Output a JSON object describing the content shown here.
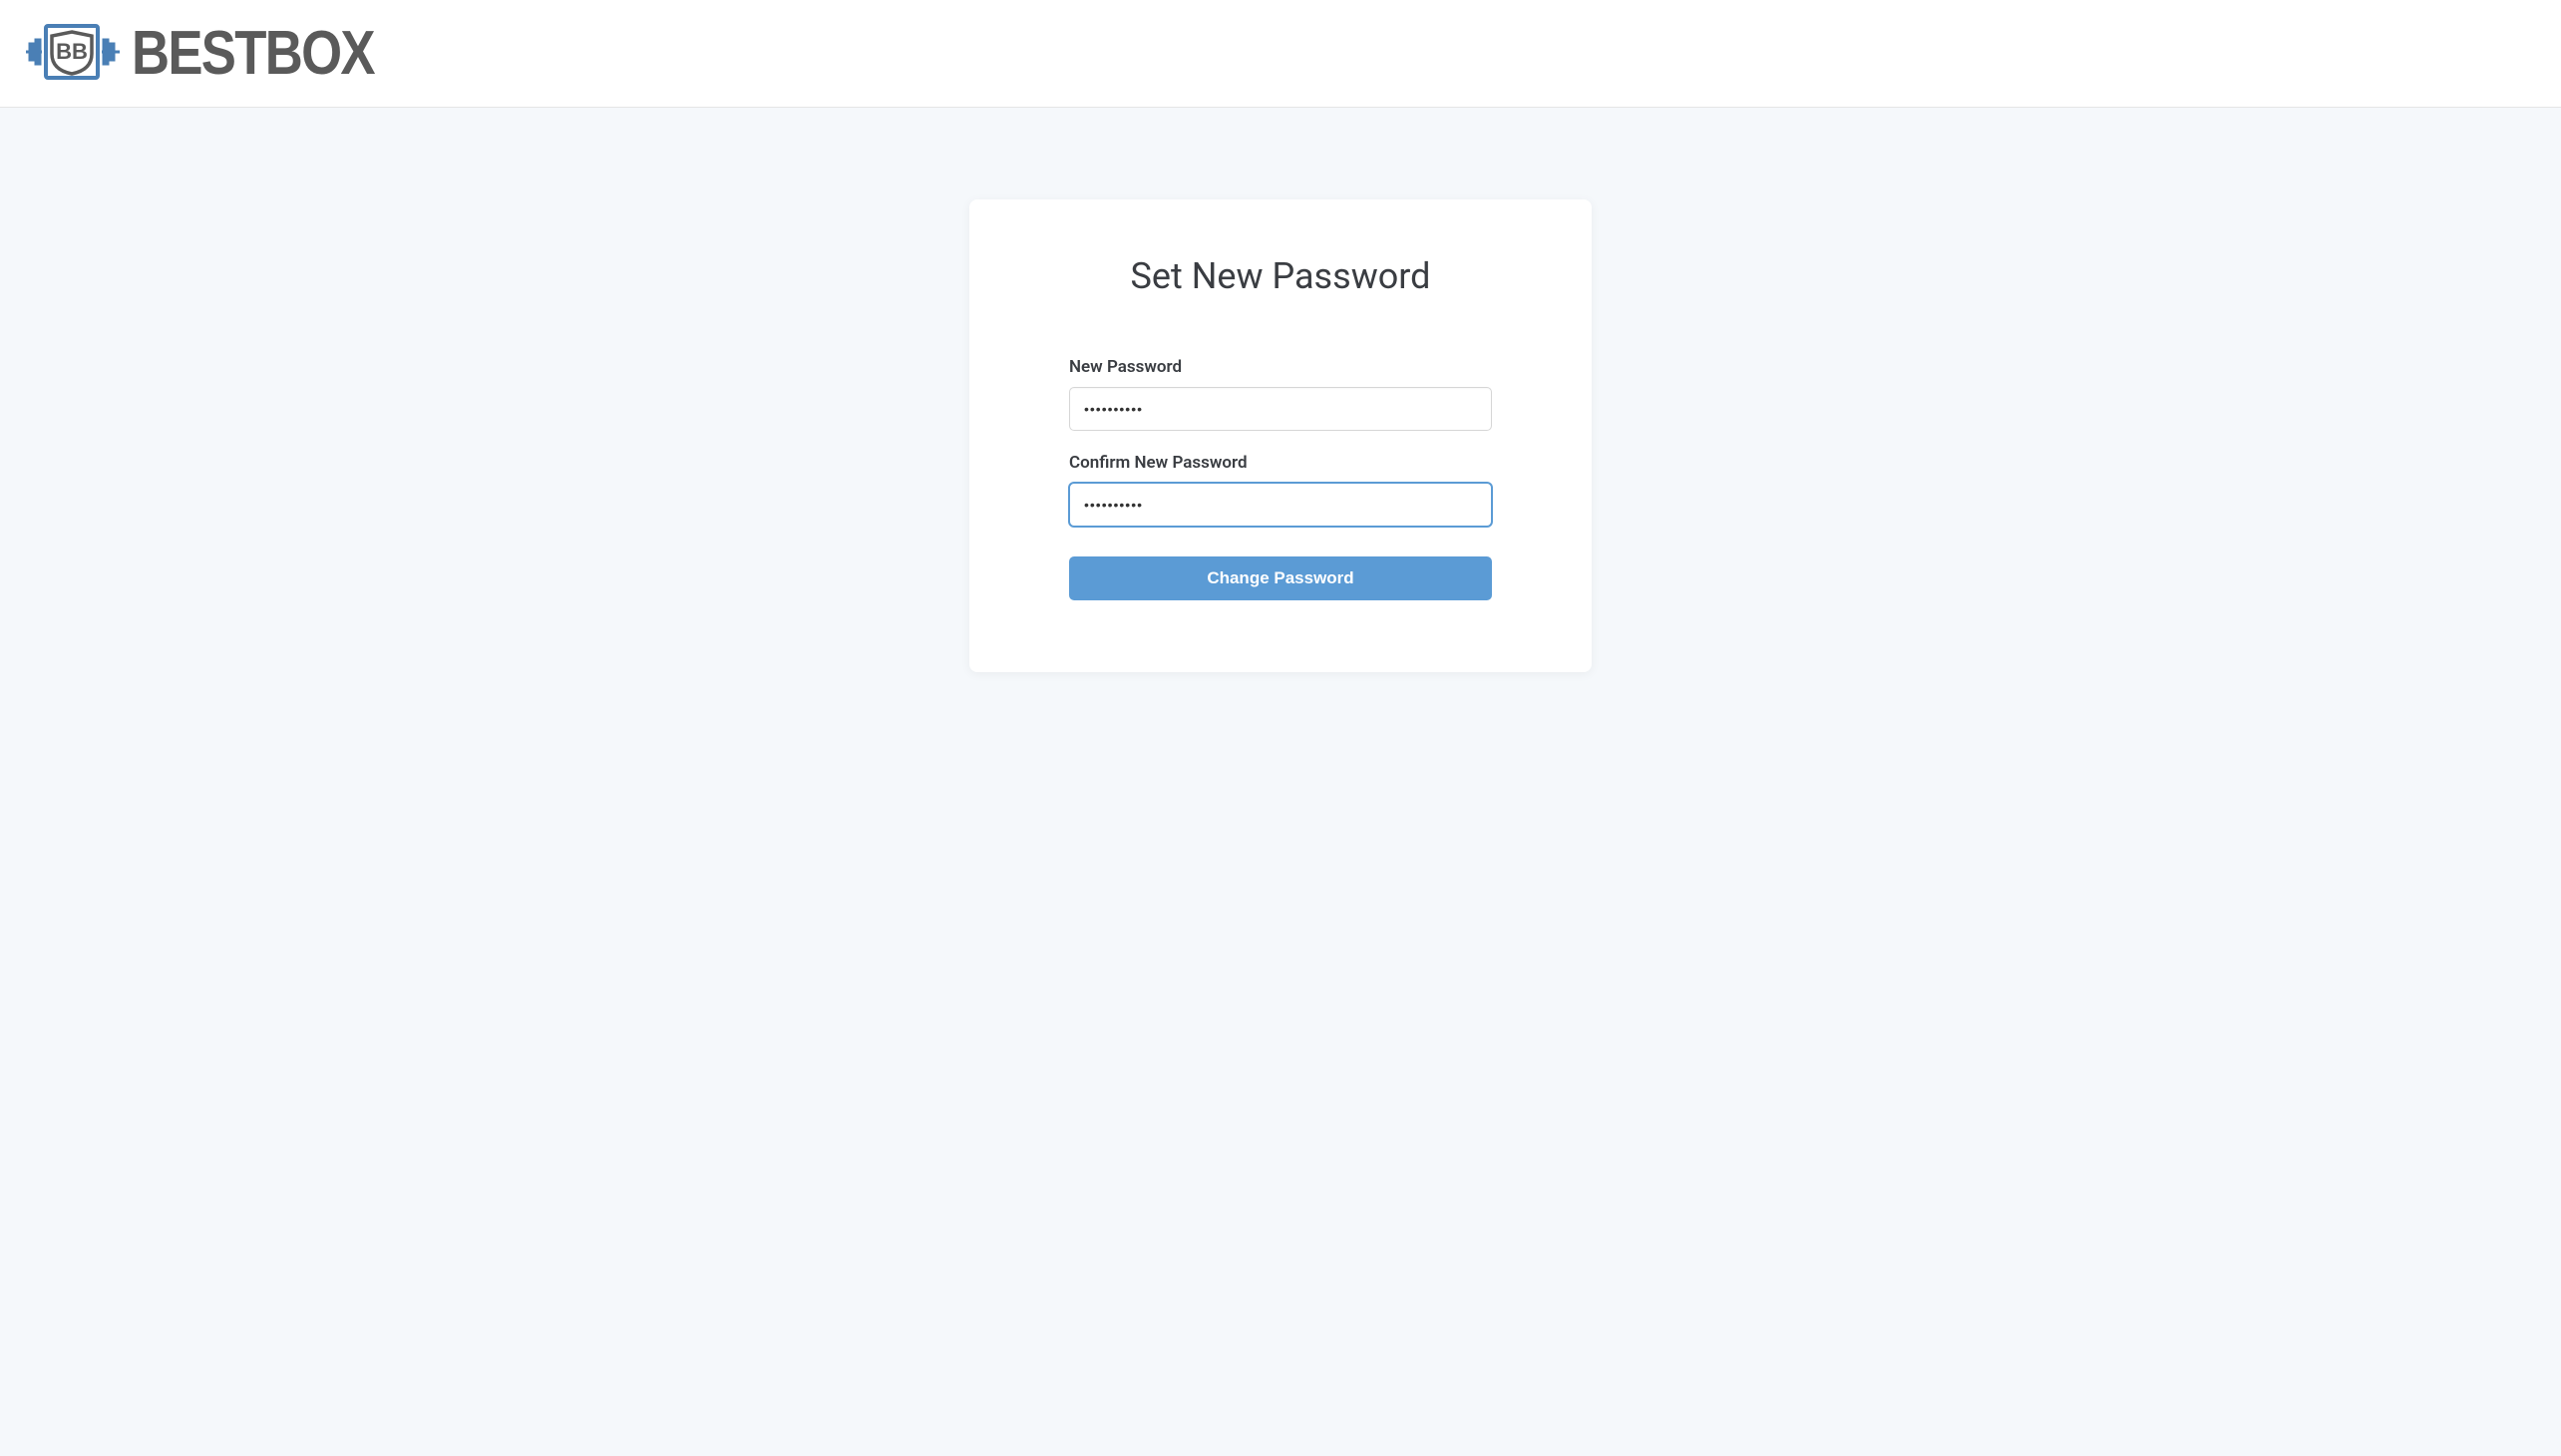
{
  "brand": {
    "name": "BESTBOX"
  },
  "card": {
    "title": "Set New Password",
    "fields": {
      "new_password": {
        "label": "New Password",
        "value": "••••••••••"
      },
      "confirm_password": {
        "label": "Confirm New Password",
        "value": "••••••••••"
      }
    },
    "submit_label": "Change Password"
  }
}
